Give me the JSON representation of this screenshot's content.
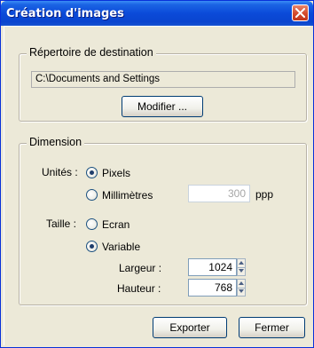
{
  "window": {
    "title": "Création d'images"
  },
  "destination": {
    "legend": "Répertoire de destination",
    "path": "C:\\Documents and Settings",
    "modify_label": "Modifier ..."
  },
  "dimension": {
    "legend": "Dimension",
    "unites_label": "Unités :",
    "unit_options": [
      {
        "label": "Pixels",
        "checked": true
      },
      {
        "label": "Millimètres",
        "checked": false
      }
    ],
    "ppp_value": "300",
    "ppp_label": "ppp",
    "taille_label": "Taille :",
    "size_options": [
      {
        "label": "Ecran",
        "checked": false
      },
      {
        "label": "Variable",
        "checked": true
      }
    ],
    "largeur_label": "Largeur :",
    "largeur_value": "1024",
    "hauteur_label": "Hauteur :",
    "hauteur_value": "768"
  },
  "footer": {
    "export_label": "Exporter",
    "close_label": "Fermer"
  }
}
